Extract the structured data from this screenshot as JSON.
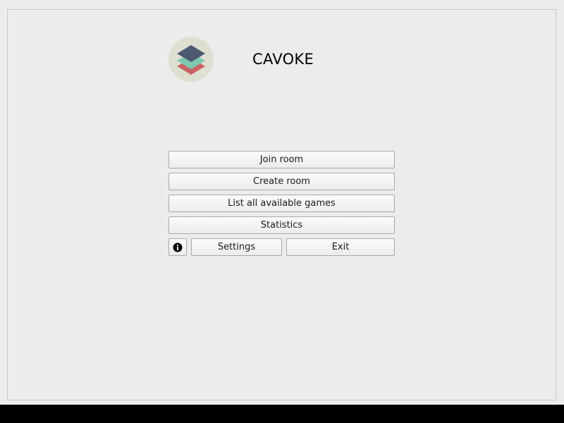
{
  "app": {
    "title": "CAVOKE",
    "logo_icon": "layered-stack-logo",
    "logo_colors": [
      "#dedfd0",
      "#4b5a70",
      "#7ec8b0",
      "#c96464"
    ]
  },
  "menu": {
    "join_room": "Join room",
    "create_room": "Create room",
    "list_games": "List all available games",
    "statistics": "Statistics",
    "info_icon": "info-icon",
    "settings": "Settings",
    "exit": "Exit"
  }
}
